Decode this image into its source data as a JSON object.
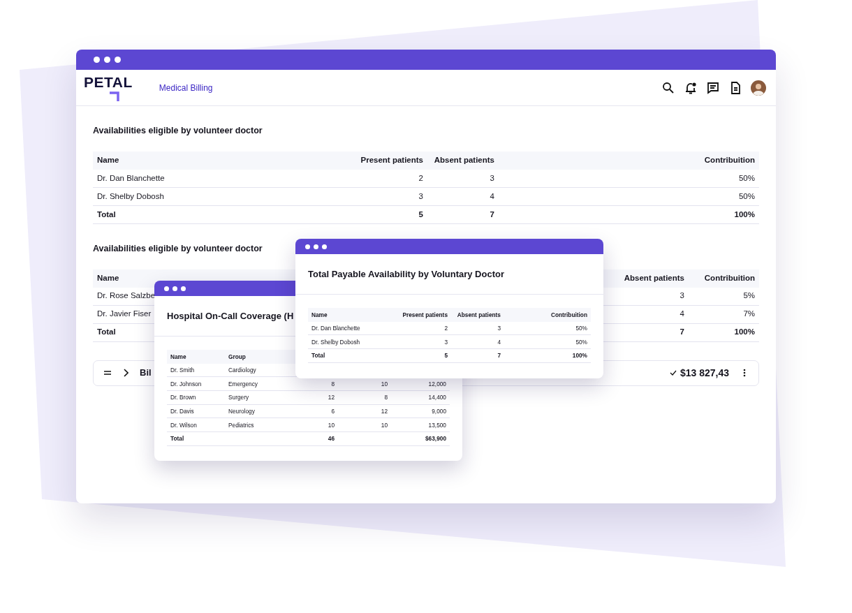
{
  "app": {
    "logo": "PETAL",
    "section_link": "Medical Billing"
  },
  "sections": [
    {
      "title": "Availabilities eligible by volunteer doctor",
      "table": {
        "columns": [
          {
            "label": "Name"
          },
          {
            "label": "Present patients"
          },
          {
            "label": "Absent patients"
          },
          {
            "label": "Contribuition"
          }
        ],
        "rows": [
          {
            "kind": "data",
            "cells": [
              "Dr. Dan Blanchette",
              "2",
              "3",
              "50%"
            ]
          },
          {
            "kind": "data",
            "cells": [
              "Dr. Shelby Dobosh",
              "3",
              "4",
              "50%"
            ]
          },
          {
            "kind": "total",
            "cells": [
              "Total",
              "5",
              "7",
              "100%"
            ]
          }
        ]
      }
    },
    {
      "title": "Availabilities eligible by volunteer doctor",
      "table": {
        "columns": [
          {
            "label": "Name"
          },
          {
            "label": "Absent patients"
          },
          {
            "label": "Contribuition"
          }
        ],
        "rows": [
          {
            "kind": "data",
            "cells": [
              "Dr. Rose Salzbe",
              "3",
              "5%"
            ]
          },
          {
            "kind": "data",
            "cells": [
              "Dr. Javier Fiser",
              "4",
              "7%"
            ]
          },
          {
            "kind": "total",
            "cells": [
              "Total",
              "7",
              "100%"
            ]
          }
        ]
      }
    }
  ],
  "billing_row": {
    "label": "Bil",
    "amount": "$13 827,43"
  },
  "overlays": [
    {
      "title": "Hospital On-Call Coverage (H",
      "table": {
        "columns": [
          {
            "label": "Name"
          },
          {
            "label": "Group"
          }
        ],
        "rows": [
          {
            "kind": "data",
            "cells": [
              "Dr. Smith",
              "Cardiology"
            ]
          },
          {
            "kind": "data",
            "cells": [
              "Dr. Johnson",
              "Emergency",
              "8",
              "10",
              "12,000"
            ]
          },
          {
            "kind": "data",
            "cells": [
              "Dr. Brown",
              "Surgery",
              "12",
              "8",
              "14,400"
            ]
          },
          {
            "kind": "data",
            "cells": [
              "Dr. Davis",
              "Neurology",
              "6",
              "12",
              "9,000"
            ]
          },
          {
            "kind": "data",
            "cells": [
              "Dr. Wilson",
              "Pediatrics",
              "10",
              "10",
              "13,500"
            ]
          },
          {
            "kind": "total",
            "cells": [
              "Total",
              "",
              "46",
              "",
              "$63,900"
            ]
          }
        ]
      }
    },
    {
      "title": "Total Payable Availability by Voluntary Doctor",
      "table": {
        "columns": [
          {
            "label": "Name"
          },
          {
            "label": "Present patients"
          },
          {
            "label": "Absent patients"
          },
          {
            "label": "Contribuition"
          }
        ],
        "rows": [
          {
            "kind": "data",
            "cells": [
              "Dr. Dan Blanchette",
              "2",
              "3",
              "50%"
            ]
          },
          {
            "kind": "data",
            "cells": [
              "Dr. Shelby Dobosh",
              "3",
              "4",
              "50%"
            ]
          },
          {
            "kind": "total",
            "cells": [
              "Total",
              "5",
              "7",
              "100%"
            ]
          }
        ]
      }
    }
  ]
}
